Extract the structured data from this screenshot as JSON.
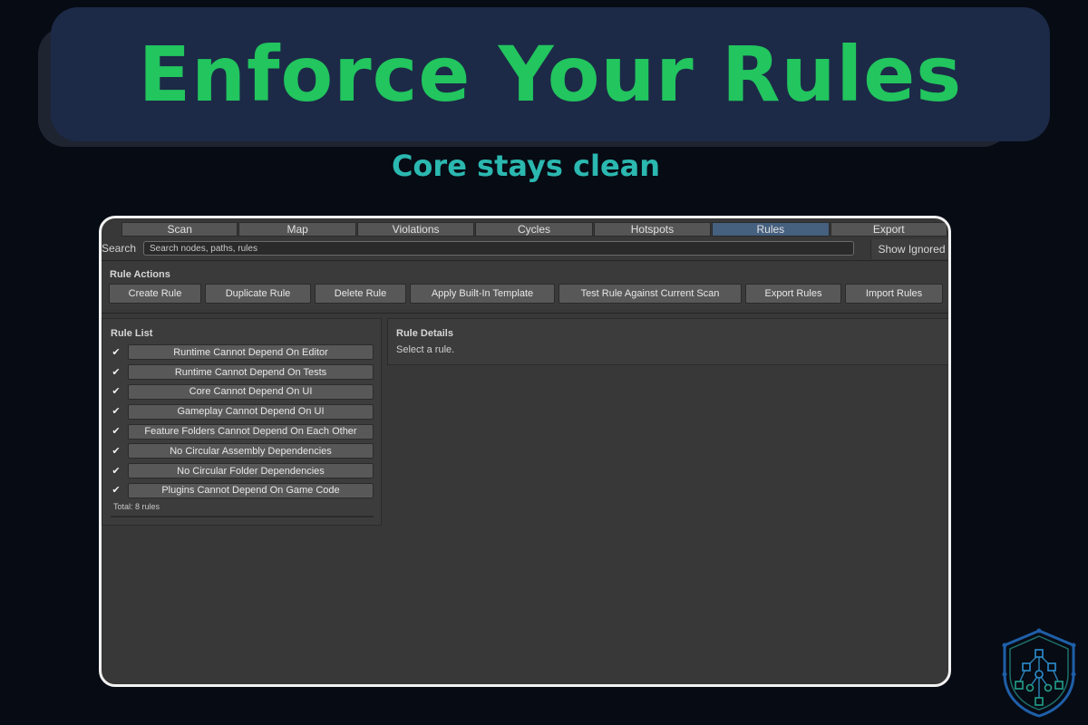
{
  "banner": {
    "title": "Enforce Your Rules",
    "subtitle": "Core stays clean"
  },
  "tabs": [
    {
      "label": "Scan",
      "active": false
    },
    {
      "label": "Map",
      "active": false
    },
    {
      "label": "Violations",
      "active": false
    },
    {
      "label": "Cycles",
      "active": false
    },
    {
      "label": "Hotspots",
      "active": false
    },
    {
      "label": "Rules",
      "active": true
    },
    {
      "label": "Export",
      "active": false
    }
  ],
  "search": {
    "label": "Search",
    "placeholder": "Search nodes, paths, rules",
    "value": ""
  },
  "toggle": {
    "show_ignored_label": "Show Ignored"
  },
  "rule_actions": {
    "title": "Rule Actions",
    "buttons": [
      "Create Rule",
      "Duplicate Rule",
      "Delete Rule",
      "Apply Built-In Template",
      "Test Rule Against Current Scan",
      "Export Rules",
      "Import Rules"
    ]
  },
  "rule_list": {
    "title": "Rule List",
    "rules": [
      {
        "name": "Runtime Cannot Depend On Editor",
        "enabled": true
      },
      {
        "name": "Runtime Cannot Depend On Tests",
        "enabled": true
      },
      {
        "name": "Core Cannot Depend On UI",
        "enabled": true
      },
      {
        "name": "Gameplay Cannot Depend On UI",
        "enabled": true
      },
      {
        "name": "Feature Folders Cannot Depend On Each Other",
        "enabled": true
      },
      {
        "name": "No Circular Assembly Dependencies",
        "enabled": true
      },
      {
        "name": "No Circular Folder Dependencies",
        "enabled": true
      },
      {
        "name": "Plugins Cannot Depend On Game Code",
        "enabled": true
      }
    ],
    "total": "Total: 8 rules"
  },
  "rule_details": {
    "title": "Rule Details",
    "empty_text": "Select a rule."
  },
  "colors": {
    "background": "#070b14",
    "banner": "#1c2a47",
    "title_green": "#22c55e",
    "subtitle_teal": "#2bb8b0",
    "active_tab": "#46607f"
  },
  "icons": {
    "logo": "shield-graph-logo",
    "checkbox": "checkmark-icon"
  }
}
